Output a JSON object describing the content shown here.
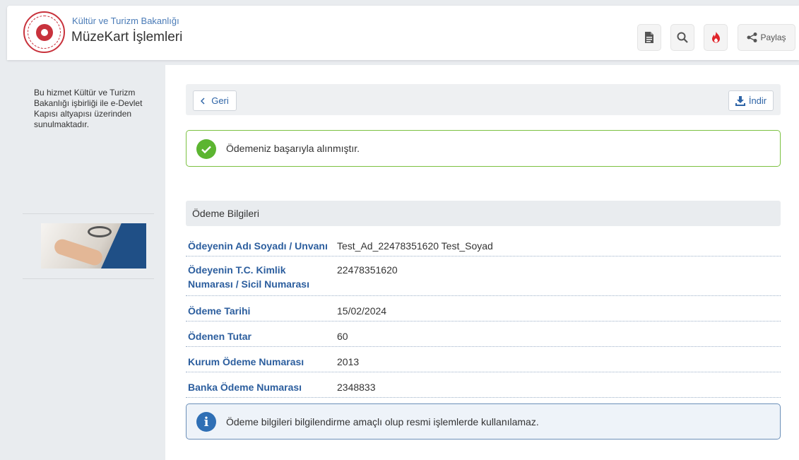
{
  "header": {
    "ministry": "Kültür ve Turizm Bakanlığı",
    "title": "MüzeKart İşlemleri",
    "buttons": {
      "share_label": "Paylaş"
    },
    "icons": [
      "document-icon",
      "search-icon",
      "fire-icon",
      "share-icon"
    ]
  },
  "sidebar": {
    "description": "Bu hizmet Kültür ve Turizm Bakanlığı işbirliği ile e-Devlet Kapısı altyapısı üzerinden sunulmaktadır."
  },
  "toolbar": {
    "back_label": "Geri",
    "download_label": "İndir"
  },
  "success_alert": {
    "message": "Ödemeniz başarıyla alınmıştır."
  },
  "payment": {
    "section_title": "Ödeme Bilgileri",
    "rows": [
      {
        "label": "Ödeyenin Adı Soyadı / Unvanı",
        "value": "Test_Ad_22478351620 Test_Soyad"
      },
      {
        "label": "Ödeyenin T.C. Kimlik Numarası / Sicil Numarası",
        "value": "22478351620"
      },
      {
        "label": "Ödeme Tarihi",
        "value": "15/02/2024"
      },
      {
        "label": "Ödenen Tutar",
        "value": "60"
      },
      {
        "label": "Kurum Ödeme Numarası",
        "value": "2013"
      },
      {
        "label": "Banka Ödeme Numarası",
        "value": "2348833"
      }
    ]
  },
  "info_alert": {
    "message": "Ödeme bilgileri bilgilendirme amaçlı olup resmi işlemlerde kullanılamaz."
  },
  "colors": {
    "accent_blue": "#2c5e9e",
    "success_green": "#5cb531",
    "brand_red": "#c8323c"
  }
}
